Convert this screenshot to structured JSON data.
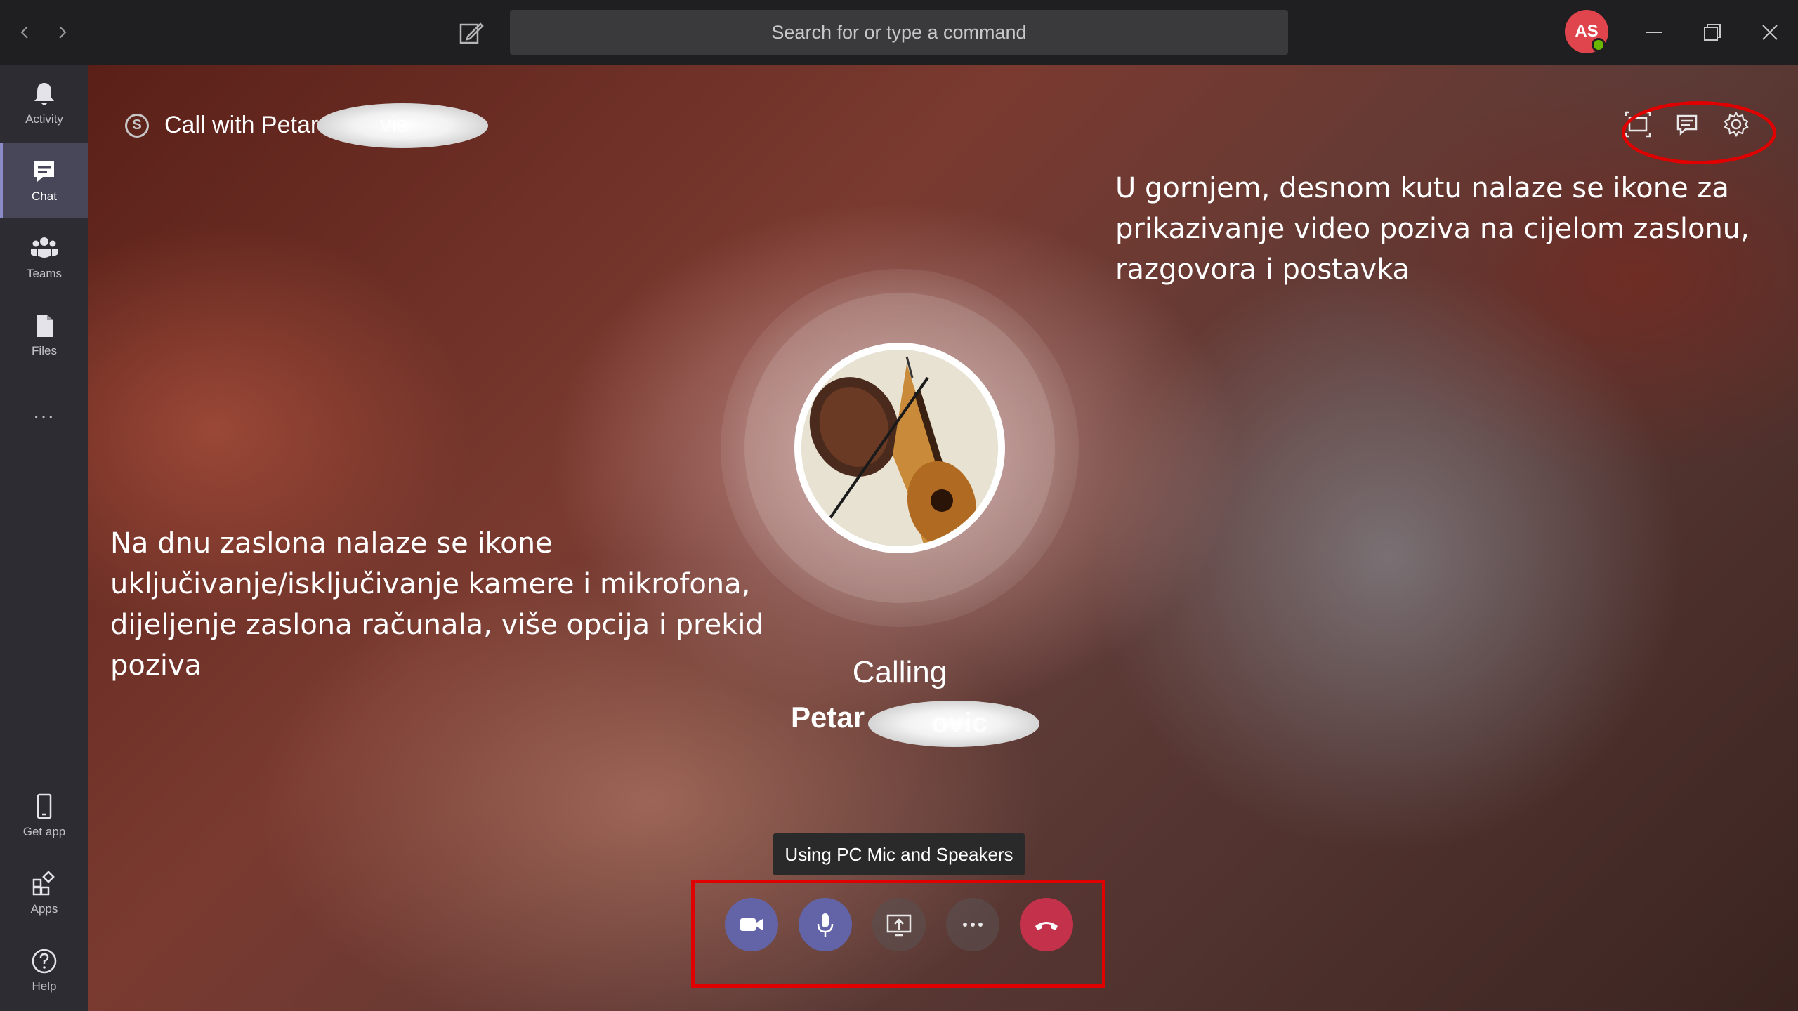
{
  "search": {
    "placeholder": "Search for or type a command"
  },
  "user": {
    "initials": "AS",
    "status_color": "#6bb700"
  },
  "rail": {
    "items": [
      {
        "label": "Activity",
        "icon": "bell-icon"
      },
      {
        "label": "Chat",
        "icon": "chat-icon"
      },
      {
        "label": "Teams",
        "icon": "teams-icon"
      },
      {
        "label": "Files",
        "icon": "files-icon"
      },
      {
        "label": "...",
        "icon": "more-icon"
      }
    ],
    "bottom_items": [
      {
        "label": "Get app",
        "icon": "phone-icon"
      },
      {
        "label": "Apps",
        "icon": "apps-icon"
      },
      {
        "label": "Help",
        "icon": "help-icon"
      }
    ]
  },
  "call": {
    "title": "Call with Petar",
    "title_redacted_tail": "vic",
    "status": "Calling",
    "callee_first": "Petar",
    "callee_redacted_tail": "ovic",
    "device_tooltip": "Using PC Mic and Speakers"
  },
  "annotations": {
    "top_right": "U gornjem, desnom kutu nalaze se ikone za prikazivanje video poziva na cijelom zaslonu, razgovora i postavka",
    "bottom_left": "Na dnu zaslona nalaze se ikone uključivanje/isključivanje kamere i mikrofona, dijeljenje zaslona računala, više opcija i prekid poziva"
  },
  "colors": {
    "accent": "#6264a7",
    "hangup": "#c4314b",
    "highlight": "#e00000",
    "rail": "#2d2c33"
  }
}
